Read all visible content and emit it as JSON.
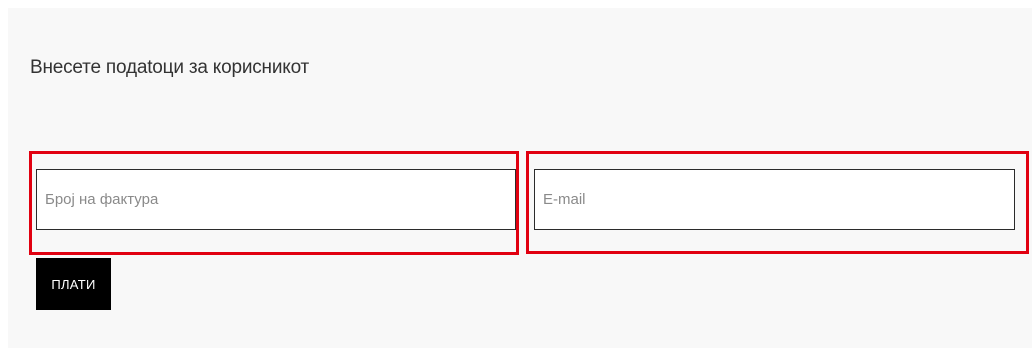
{
  "form": {
    "heading": "Внесете подаtоци за корисникот",
    "invoice_placeholder": "Број на фактура",
    "invoice_value": "",
    "email_placeholder": "E-mail",
    "email_value": "",
    "pay_label": "ПЛАТИ"
  },
  "colors": {
    "highlight": "#e10010",
    "button_bg": "#000000",
    "panel_bg": "#f8f8f8"
  }
}
